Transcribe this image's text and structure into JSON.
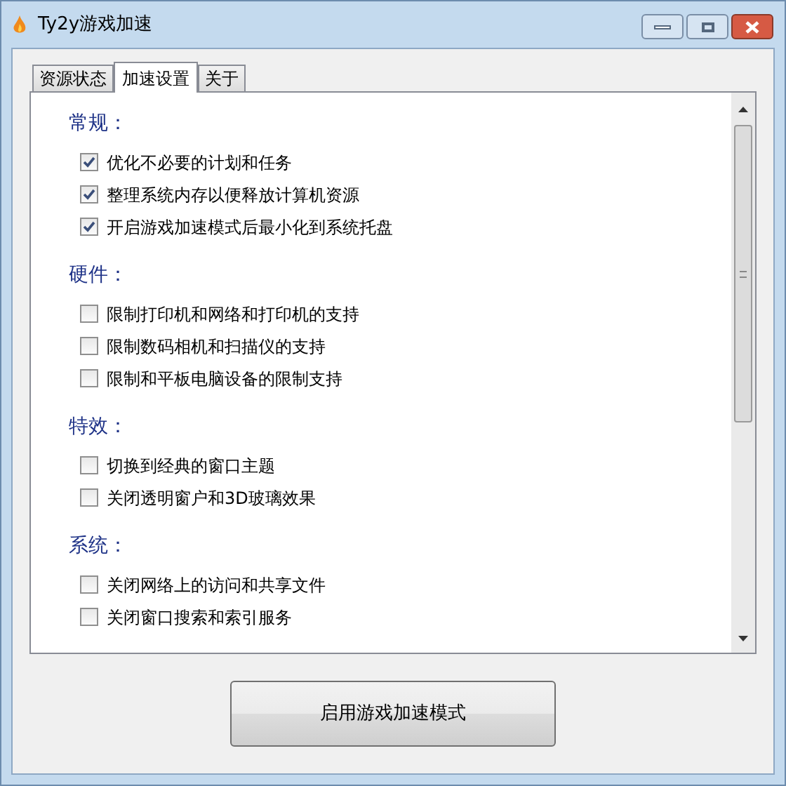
{
  "window": {
    "title": "Ty2y游戏加速"
  },
  "tabs": [
    {
      "label": "资源状态",
      "selected": false
    },
    {
      "label": "加速设置",
      "selected": true
    },
    {
      "label": "关于",
      "selected": false
    }
  ],
  "sections": [
    {
      "title": "常规：",
      "items": [
        {
          "label": "优化不必要的计划和任务",
          "checked": true
        },
        {
          "label": "整理系统内存以便释放计算机资源",
          "checked": true
        },
        {
          "label": "开启游戏加速模式后最小化到系统托盘",
          "checked": true
        }
      ]
    },
    {
      "title": "硬件：",
      "items": [
        {
          "label": "限制打印机和网络和打印机的支持",
          "checked": false
        },
        {
          "label": "限制数码相机和扫描仪的支持",
          "checked": false
        },
        {
          "label": "限制和平板电脑设备的限制支持",
          "checked": false
        }
      ]
    },
    {
      "title": "特效：",
      "items": [
        {
          "label": "切换到经典的窗口主题",
          "checked": false
        },
        {
          "label": "关闭透明窗户和3D玻璃效果",
          "checked": false
        }
      ]
    },
    {
      "title": "系统：",
      "items": [
        {
          "label": "关闭网络上的访问和共享文件",
          "checked": false
        },
        {
          "label": "关闭窗口搜索和索引服务",
          "checked": false
        }
      ]
    }
  ],
  "start_button": "启用游戏加速模式"
}
